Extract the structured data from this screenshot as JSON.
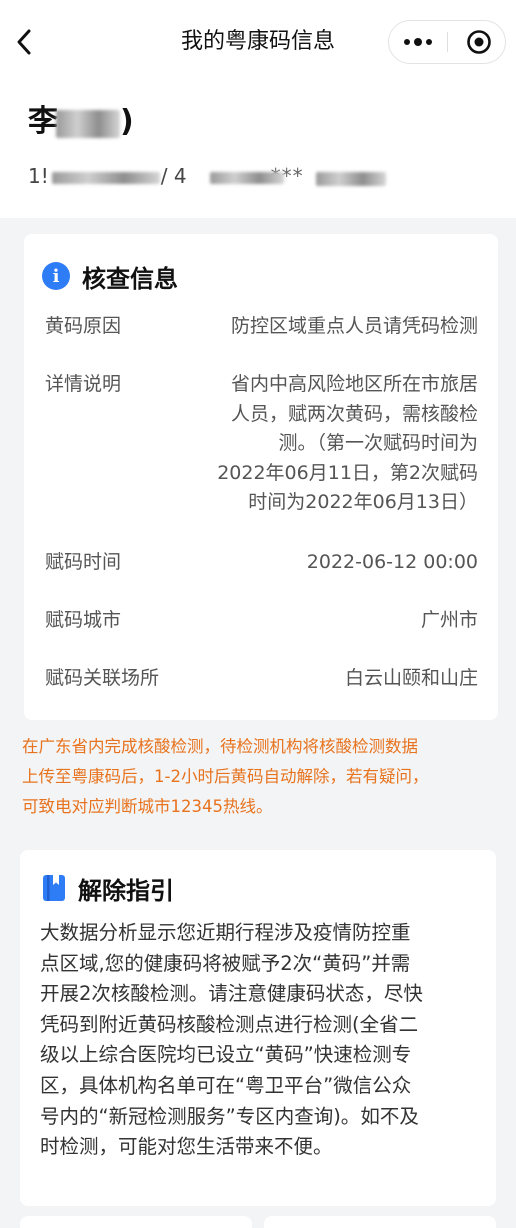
{
  "nav": {
    "title": "我的粤康码信息",
    "back_icon": "chevron-left-icon",
    "more_icon": "more-dots-icon",
    "close_icon": "target-circle-icon"
  },
  "profile": {
    "name_visible": "李",
    "name_tail": ")",
    "phone_prefix": "1!",
    "separator": "/",
    "id_prefix": "4",
    "id_mask": "***"
  },
  "check_info": {
    "title": "核查信息",
    "icon": "info-icon",
    "rows": [
      {
        "label": "黄码原因",
        "value": "防控区域重点人员请凭码检测"
      },
      {
        "label": "详情说明",
        "value": "省内中高风险地区所在市旅居人员，赋两次黄码，需核酸检测。（第一次赋码时间为2022年06月11日，第2次赋码时间为2022年06月13日）"
      },
      {
        "label": "赋码时间",
        "value": "2022-06-12 00:00"
      },
      {
        "label": "赋码城市",
        "value": "广州市"
      },
      {
        "label": "赋码关联场所",
        "value": "白云山颐和山庄"
      }
    ],
    "detail_lines": [
      "省内中高风险地区所在市旅居",
      "人员，赋两次黄码，需核酸检",
      "测。（第一次赋码时间为",
      "2022年06月11日，第2次赋码",
      "时间为2022年06月13日）"
    ]
  },
  "notice": {
    "line1": "在广东省内完成核酸检测，待检测机构将核酸检测数据",
    "line2_a": "上传至粤康码后，1-2小时后黄码自动解除，",
    "line2_b": "若有疑问，",
    "line3": "可致电对应判断城市12345热线。",
    "color": "#e8731e"
  },
  "guide": {
    "title": "解除指引",
    "icon": "book-icon",
    "lines": [
      "大数据分析显示您近期行程涉及疫情防控重",
      "点区域,您的健康码将被赋予2次“黄码”并需",
      "开展2次核酸检测。请注意健康码状态，尽快",
      "凭码到附近黄码核酸检测点进行检测(全省二",
      "级以上综合医院均已设立“黄码”快速检测专",
      "区，具体机构名单可在“粤卫平台”微信公众",
      "号内的“新冠检测服务”专区内查询)。如不及",
      "时检测，可能对您生活带来不便。"
    ]
  },
  "colors": {
    "accent_blue": "#2f7df6",
    "notice_orange": "#e8731e",
    "background": "#f3f4f6"
  }
}
